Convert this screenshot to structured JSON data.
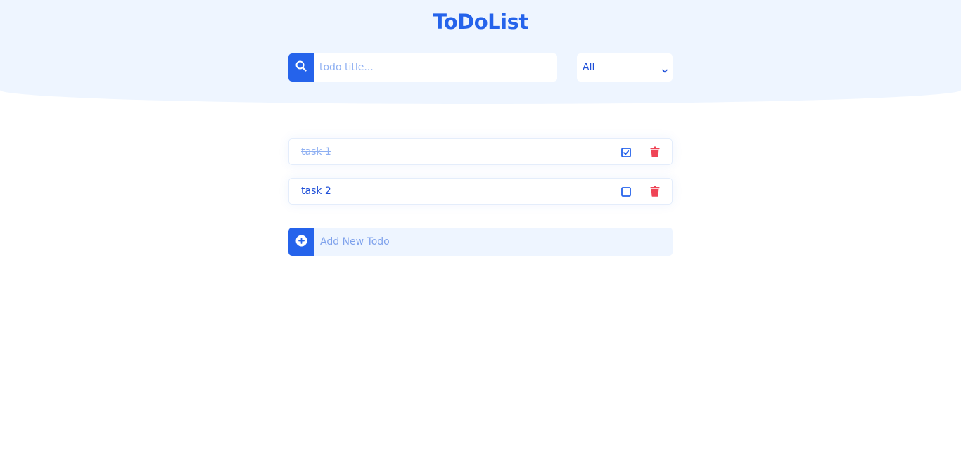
{
  "app": {
    "title": "ToDoList"
  },
  "search": {
    "placeholder": "todo title...",
    "value": ""
  },
  "filter": {
    "selected": "All"
  },
  "todos": [
    {
      "label": "task 1",
      "completed": true
    },
    {
      "label": "task 2",
      "completed": false
    }
  ],
  "add_todo": {
    "placeholder": "Add New Todo",
    "value": ""
  },
  "icons": {
    "search": "search-icon",
    "chevron": "chevron-down-icon",
    "checked": "checkbox-checked-icon",
    "unchecked": "checkbox-empty-icon",
    "delete": "trash-icon",
    "add": "plus-circle-icon"
  },
  "colors": {
    "accent": "#2563eb",
    "header_bg": "#eef5ff",
    "delete": "#ef4456",
    "muted_text": "#8fb0f2"
  }
}
